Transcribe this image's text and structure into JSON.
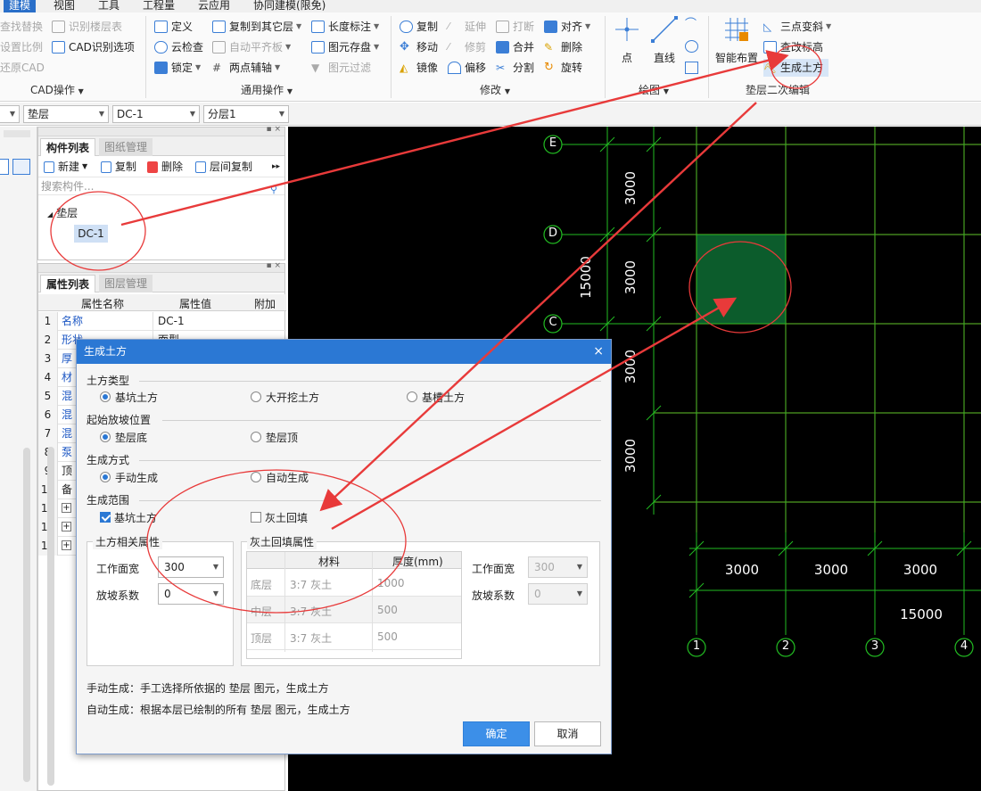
{
  "menu": {
    "items": [
      "建模",
      "视图",
      "工具",
      "工程量",
      "云应用",
      "协同建模(限免)"
    ],
    "active_index": 0
  },
  "ribbon": {
    "cad_ops": {
      "find_replace": "查找替换",
      "set_scale": "设置比例",
      "restore_cad": "还原CAD",
      "identify_floor_table": "识别楼层表",
      "cad_identify_options": "CAD识别选项",
      "group_label": "CAD操作"
    },
    "general_ops": {
      "define": "定义",
      "copy_to_other_floor": "复制到其它层",
      "length_dim": "长度标注",
      "cloud_check": "云检查",
      "auto_flat_slab": "自动平齐板",
      "element_save": "图元存盘",
      "lock": "锁定",
      "two_point_axis": "两点辅轴",
      "element_filter": "图元过滤",
      "group_label": "通用操作"
    },
    "modify_ops": {
      "copy": "复制",
      "extend": "延伸",
      "break": "打断",
      "align": "对齐",
      "move": "移动",
      "trim": "修剪",
      "merge": "合并",
      "delete": "删除",
      "mirror": "镜像",
      "offset": "偏移",
      "split": "分割",
      "rotate": "旋转",
      "group_label": "修改"
    },
    "draw_ops": {
      "point": "点",
      "line": "直线",
      "group_label": "绘图"
    },
    "cushion_ops": {
      "smart_layout": "智能布置",
      "three_point_slope": "三点变斜",
      "check_modify_elev": "查改标高",
      "gen_earthwork": "生成土方",
      "group_label": "垫层二次编辑"
    }
  },
  "selectors": {
    "type": "垫层",
    "name": "DC-1",
    "sublayer": "分层1"
  },
  "component_panel": {
    "tabs": [
      "构件列表",
      "图纸管理"
    ],
    "tools": [
      "新建",
      "复制",
      "删除",
      "层间复制"
    ],
    "search_placeholder": "搜索构件...",
    "tree_root": "垫层",
    "tree_child": "DC-1"
  },
  "property_panel": {
    "tabs": [
      "属性列表",
      "图层管理"
    ],
    "columns": [
      "属性名称",
      "属性值",
      "附加"
    ],
    "rows": [
      {
        "num": "1",
        "name": "名称",
        "value": "DC-1"
      },
      {
        "num": "2",
        "name": "形状",
        "value": "面型"
      },
      {
        "num": "3",
        "name": "厚",
        "value": ""
      },
      {
        "num": "4",
        "name": "材",
        "value": ""
      },
      {
        "num": "5",
        "name": "混",
        "value": ""
      },
      {
        "num": "6",
        "name": "混",
        "value": ""
      },
      {
        "num": "7",
        "name": "混",
        "value": ""
      },
      {
        "num": "8",
        "name": "泵",
        "value": ""
      },
      {
        "num": "9",
        "name": "顶",
        "value": ""
      },
      {
        "num": "10",
        "name": "备",
        "value": ""
      },
      {
        "num": "11",
        "name": "",
        "value": ""
      },
      {
        "num": "14",
        "name": "",
        "value": ""
      },
      {
        "num": "19",
        "name": "",
        "value": ""
      }
    ]
  },
  "cad": {
    "axis_letters": [
      "E",
      "D",
      "C"
    ],
    "axis_numbers": [
      "1",
      "2",
      "3",
      "4"
    ],
    "vertical_dims": [
      "3000",
      "3000",
      "3000",
      "3000"
    ],
    "vertical_total": "15000",
    "horizontal_dims": [
      "3000",
      "3000",
      "3000"
    ],
    "horizontal_total": "15000",
    "colors": {
      "grid_red": "#ff2222",
      "grid_green": "#22bb22",
      "cushion_fill": "#0c5c2c"
    }
  },
  "dialog": {
    "title": "生成土方",
    "earthwork_type": {
      "label": "土方类型",
      "options": [
        "基坑土方",
        "大开挖土方",
        "基槽土方"
      ],
      "selected": 0
    },
    "start_slope": {
      "label": "起始放坡位置",
      "options": [
        "垫层底",
        "垫层顶"
      ],
      "selected": 0
    },
    "gen_method": {
      "label": "生成方式",
      "options": [
        "手动生成",
        "自动生成"
      ],
      "selected": 0
    },
    "gen_range": {
      "label": "生成范围",
      "pit": {
        "label": "基坑土方",
        "checked": true
      },
      "backfill": {
        "label": "灰土回填",
        "checked": false
      }
    },
    "earth_props": {
      "legend": "土方相关属性",
      "work_width_label": "工作面宽",
      "work_width": "300",
      "slope_label": "放坡系数",
      "slope": "0"
    },
    "backfill_props": {
      "legend": "灰土回填属性",
      "columns": [
        "材料",
        "厚度(mm)"
      ],
      "rows": [
        {
          "layer": "底层",
          "material": "3:7 灰土",
          "thickness": "1000"
        },
        {
          "layer": "中层",
          "material": "3:7 灰土",
          "thickness": "500"
        },
        {
          "layer": "顶层",
          "material": "3:7 灰土",
          "thickness": "500"
        }
      ],
      "work_width_label": "工作面宽",
      "work_width": "300",
      "slope_label": "放坡系数",
      "slope": "0"
    },
    "note_manual": "手动生成：手工选择所依据的 垫层 图元，生成土方",
    "note_auto": "自动生成：根据本层已绘制的所有 垫层 图元，生成土方",
    "ok": "确定",
    "cancel": "取消"
  }
}
